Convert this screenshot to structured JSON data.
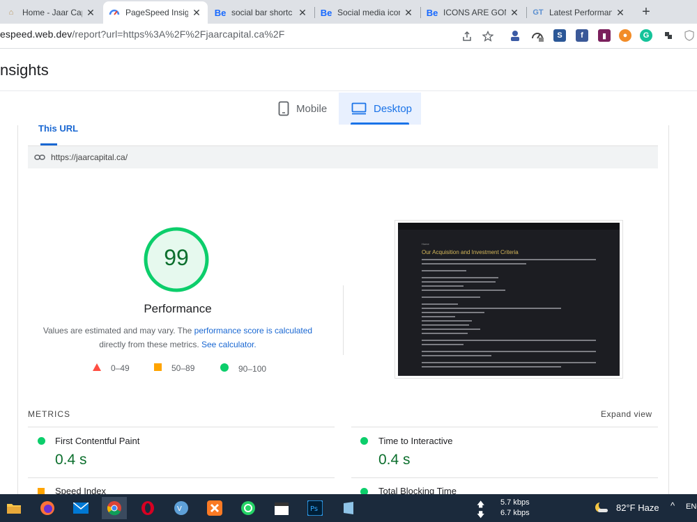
{
  "browser": {
    "tabs": [
      {
        "title": "Home - Jaar Capi",
        "close": "✕"
      },
      {
        "title": "PageSpeed Insigh",
        "close": "✕"
      },
      {
        "title": "social bar shortc",
        "close": "✕",
        "favicon": "Be"
      },
      {
        "title": "Social media icon",
        "close": "✕",
        "favicon": "Be"
      },
      {
        "title": "ICONS ARE GONE",
        "close": "✕",
        "favicon": "Be"
      },
      {
        "title": "Latest Performan",
        "close": "✕",
        "favicon": "GT"
      }
    ],
    "new_tab": "+",
    "url_host": "espeed.web.dev",
    "url_path": "/report?url=https%3A%2F%2Fjaarcapital.ca%2F"
  },
  "header": {
    "title": "nsights"
  },
  "device_tabs": {
    "mobile": "Mobile",
    "desktop": "Desktop"
  },
  "report": {
    "this_url_tab": "This URL",
    "url": "https://jaarcapital.ca/",
    "score": "99",
    "category": "Performance",
    "note_prefix": "Values are estimated and may vary. The ",
    "note_link1": "performance score is calculated",
    "note_mid": "directly from these metrics. ",
    "note_link2": "See calculator.",
    "legend": [
      {
        "range": "0–49",
        "color": "#ff4e42"
      },
      {
        "range": "50–89",
        "color": "#ffa400"
      },
      {
        "range": "90–100",
        "color": "#0cce6b"
      }
    ],
    "thumbnail": {
      "breadcrumb": "Home",
      "heading": "Our Acquisition and Investment Criteria"
    }
  },
  "metrics": {
    "title": "METRICS",
    "expand": "Expand view",
    "items": [
      {
        "label": "First Contentful Paint",
        "value": "0.4 s",
        "status": "good"
      },
      {
        "label": "Time to Interactive",
        "value": "0.4 s",
        "status": "good"
      },
      {
        "label": "Speed Index",
        "value": "",
        "status": "average"
      },
      {
        "label": "Total Blocking Time",
        "value": "",
        "status": "good"
      }
    ]
  },
  "taskbar": {
    "net_up": "5.7 kbps",
    "net_down": "6.7 kbps",
    "weather": "82°F  Haze",
    "chevron": "^",
    "lang": "ENG"
  },
  "colors": {
    "accent": "#1a73e8",
    "good": "#0cce6b",
    "good_text": "#0c6f2d",
    "average": "#ffa400",
    "poor": "#ff4e42"
  }
}
